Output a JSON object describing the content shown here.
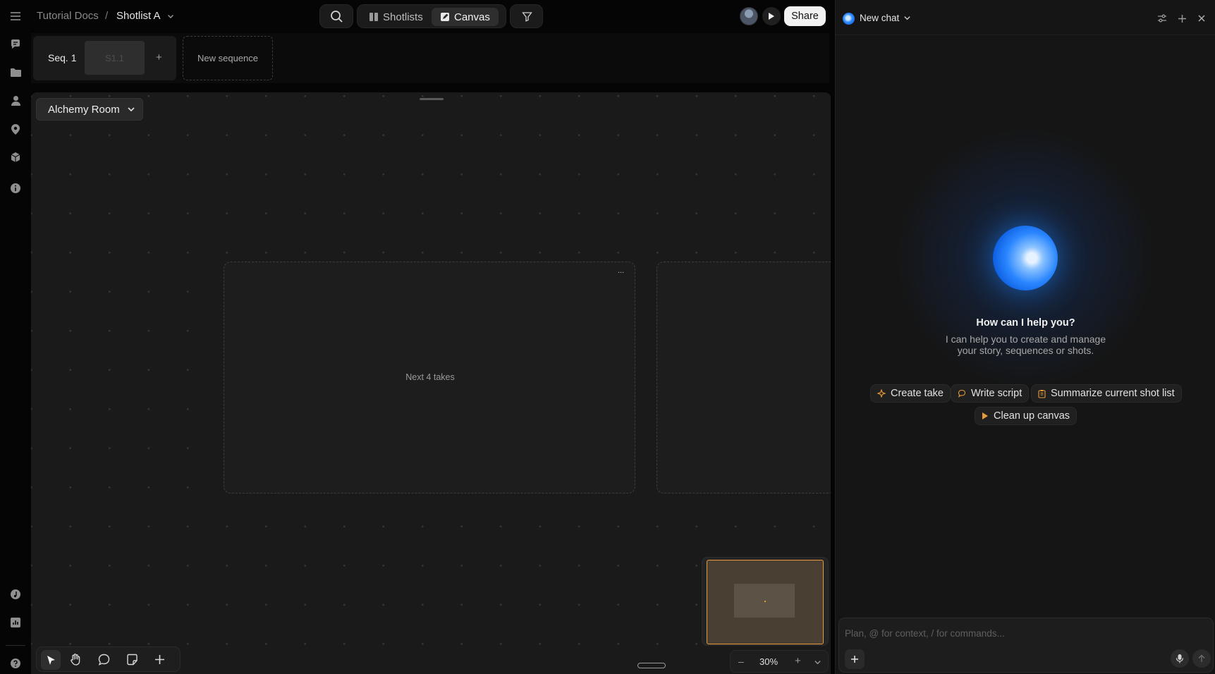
{
  "breadcrumb": {
    "root": "Tutorial Docs",
    "separator": "/",
    "current": "Shotlist A"
  },
  "view_switch": {
    "shotlists_label": "Shotlists",
    "canvas_label": "Canvas",
    "active": "Canvas"
  },
  "top_right": {
    "share_label": "Share"
  },
  "sequence_strip": {
    "sequence_label": "Seq. 1",
    "shot_label": "S1.1",
    "add_label": "+",
    "new_sequence_label": "New sequence"
  },
  "canvas": {
    "location_select": "Alchemy Room",
    "frame_label": "Next 4 takes",
    "frame_menu": "...",
    "zoom": "30%",
    "zoom_out": "–",
    "zoom_in": "+"
  },
  "chat": {
    "title": "New chat",
    "heading": "How can I help you?",
    "subtitle_line1": "I can help you to create and manage",
    "subtitle_line2": "your story, sequences or shots.",
    "suggestions": [
      "Create take",
      "Write script",
      "Summarize current shot list",
      "Clean up canvas"
    ],
    "input_placeholder": "Plan, @ for context, / for commands..."
  },
  "colors": {
    "accent_orange": "#e89a3c",
    "orb_blue": "#1e88ff",
    "canvas_bg": "#1a1a1a",
    "panel_bg": "#151515"
  },
  "icons": {
    "rail": [
      "menu-icon",
      "chat-icon",
      "folder-icon",
      "user-icon",
      "location-icon",
      "cube-icon",
      "info-icon",
      "music-icon",
      "chart-icon",
      "help-icon"
    ],
    "toolbar": [
      "select-icon",
      "hand-icon",
      "comment-icon",
      "sticky-note-icon",
      "plus-icon"
    ]
  }
}
